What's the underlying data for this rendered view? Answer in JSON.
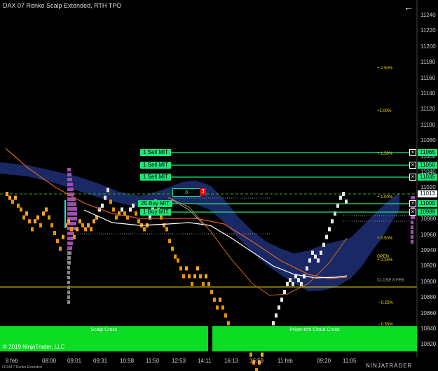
{
  "window": {
    "title": "DAX 07 Renko Scalp Extended, RTH TPO",
    "back_icon": "arrow-left-icon"
  },
  "price_axis": [
    "11240",
    "11220",
    "11200",
    "11180",
    "11160",
    "11140",
    "11120",
    "11100",
    "11080",
    "11060",
    "11040",
    "11020",
    "11000",
    "10980",
    "10960",
    "10940",
    "10920",
    "10900",
    "10880",
    "10860",
    "10840",
    "10820"
  ],
  "time_axis": [
    "8 feb",
    "08:00",
    "09:01",
    "09:31",
    "10:58",
    "11:50",
    "12:53",
    "14:11",
    "16:13",
    "16:59",
    "11 feb",
    "09:20",
    "11:05"
  ],
  "percent_labels": [
    "+ 2.50%",
    "+2.00%",
    "+ 1.50%",
    "+ 1.00%",
    "+ 0.50%",
    "+ 0.25%",
    "- 0.25%",
    "- 0.50%"
  ],
  "level_labels": {
    "open": "OPEN",
    "close": "CLOSE 8 FEB"
  },
  "orders": [
    {
      "label": "1 Sell MIT",
      "price": "11065",
      "close_icon": "close-icon"
    },
    {
      "label": "1 Sell MIT",
      "price": "11050",
      "close_icon": "close-icon"
    },
    {
      "label": "1 Sell MIT",
      "price": "11035",
      "close_icon": "close-icon"
    },
    {
      "label": "25 Buy MIT",
      "price": "11000",
      "close_icon": "close-icon"
    },
    {
      "label": "1 Buy MIT",
      "price": "10989",
      "close_icon": "close-icon"
    }
  ],
  "current_price": "11013",
  "position": {
    "qty": "3",
    "red": "3"
  },
  "panels": {
    "left": "Scalp Cross",
    "right": "Price>Ichi Cloud Cross"
  },
  "copyright": "© 2019 NinjaTrader, LLC",
  "footer_left": "FDXM 7 Renko Extended",
  "brand": "NINJATRADER",
  "colors": {
    "up_brick": "#f5a623",
    "down_brick": "#f0a010",
    "cloud": "#1b2a6b",
    "order_green": "#17e87a"
  }
}
